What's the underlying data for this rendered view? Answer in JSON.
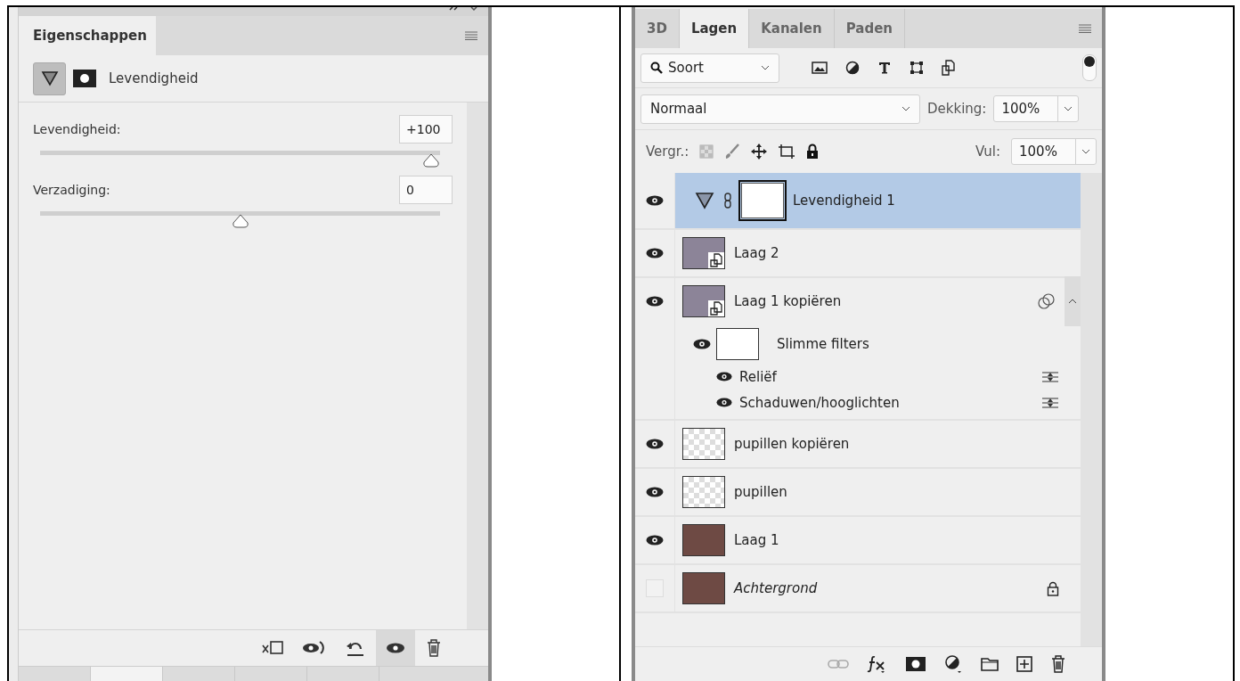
{
  "properties_panel": {
    "tab": "Eigenschappen",
    "header_label": "Levendigheid",
    "sliders": [
      {
        "label": "Levendigheid:",
        "value": "+100",
        "level": 1.0
      },
      {
        "label": "Verzadiging:",
        "value": "0",
        "level": 0.5
      }
    ]
  },
  "layers_panel": {
    "tabs": [
      {
        "label": "3D",
        "selected": false
      },
      {
        "label": "Lagen",
        "selected": true
      },
      {
        "label": "Kanalen",
        "selected": false
      },
      {
        "label": "Paden",
        "selected": false
      }
    ],
    "filter": "Soort",
    "blend_mode": "Normaal",
    "opacity_label": "Dekking:",
    "opacity": "100%",
    "lock_label": "Vergr.:",
    "fill_label": "Vul:",
    "fill": "100%",
    "layers": [
      {
        "name": "Levendigheid 1",
        "kind": "adjustment",
        "visible": true,
        "selected": true,
        "locked": false
      },
      {
        "name": "Laag 2",
        "kind": "smart_object",
        "visible": true,
        "selected": false,
        "locked": false
      },
      {
        "name": "Laag 1 kopiëren",
        "kind": "smart_object",
        "visible": true,
        "selected": false,
        "locked": false,
        "expanded": true,
        "children": [
          {
            "name": "Slimme filters",
            "visible": true,
            "children": [
              {
                "name": "Reliëf",
                "visible": true
              },
              {
                "name": "Schaduwen/hooglichten",
                "visible": true
              }
            ]
          }
        ]
      },
      {
        "name": "pupillen kopiëren",
        "kind": "transparent",
        "visible": true,
        "selected": false,
        "locked": false
      },
      {
        "name": "pupillen",
        "kind": "transparent",
        "visible": true,
        "selected": false,
        "locked": false
      },
      {
        "name": "Laag 1",
        "kind": "photo",
        "visible": true,
        "selected": false,
        "locked": false
      },
      {
        "name": "Achtergrond",
        "kind": "background",
        "visible": false,
        "selected": false,
        "locked": true
      }
    ]
  }
}
